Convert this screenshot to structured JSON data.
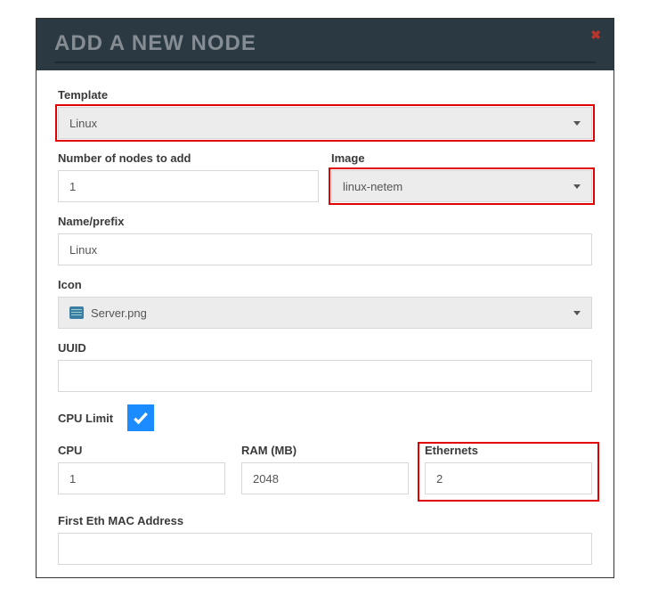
{
  "header": {
    "title": "ADD A NEW NODE"
  },
  "form": {
    "template": {
      "label": "Template",
      "value": "Linux"
    },
    "num_nodes": {
      "label": "Number of nodes to add",
      "value": "1"
    },
    "image": {
      "label": "Image",
      "value": "linux-netem"
    },
    "name_prefix": {
      "label": "Name/prefix",
      "value": "Linux"
    },
    "icon": {
      "label": "Icon",
      "value": "Server.png"
    },
    "uuid": {
      "label": "UUID",
      "value": ""
    },
    "cpu_limit": {
      "label": "CPU Limit",
      "checked": true
    },
    "cpu": {
      "label": "CPU",
      "value": "1"
    },
    "ram": {
      "label": "RAM (MB)",
      "value": "2048"
    },
    "ethernets": {
      "label": "Ethernets",
      "value": "2"
    },
    "first_eth_mac": {
      "label": "First Eth MAC Address",
      "value": ""
    }
  }
}
